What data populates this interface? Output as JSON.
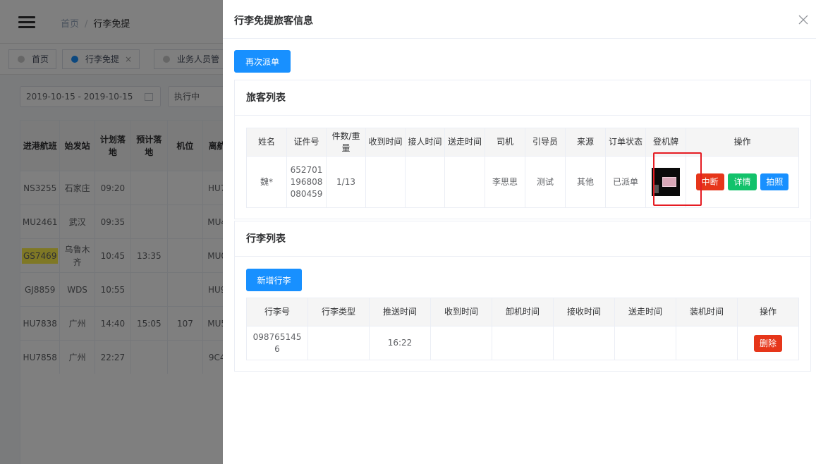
{
  "background": {
    "breadcrumb": {
      "home": "首页",
      "sep": "/",
      "current": "行李免提"
    },
    "tags": [
      {
        "label": "首页"
      },
      {
        "label": "行李免提",
        "close": "×"
      },
      {
        "label": "业务人员管"
      }
    ],
    "filters": {
      "date_range": "2019-10-15 - 2019-10-15",
      "status": "执行中"
    },
    "table": {
      "headers": [
        "进港航班",
        "始发站",
        "计划落地",
        "预计落地",
        "机位",
        "离航"
      ],
      "rows": [
        [
          "NS3255",
          "石家庄",
          "09:20",
          "",
          "",
          "HU7"
        ],
        [
          "MU2461",
          "武汉",
          "09:35",
          "",
          "",
          "MU4"
        ],
        [
          "GS7469",
          "乌鲁木齐",
          "10:45",
          "13:35",
          "",
          "MU0"
        ],
        [
          "GJ8859",
          "WDS",
          "10:55",
          "",
          "",
          "HU9"
        ],
        [
          "HU7838",
          "广州",
          "14:40",
          "15:05",
          "107",
          "MU5"
        ],
        [
          "HU7858",
          "广州",
          "22:27",
          "",
          "",
          "9C4"
        ]
      ]
    }
  },
  "drawer": {
    "title": "行李免提旅客信息",
    "redispatch_label": "再次派单",
    "passenger_section": {
      "title": "旅客列表",
      "headers": [
        "姓名",
        "证件号",
        "件数/重量",
        "收到时间",
        "接人时间",
        "送走时间",
        "司机",
        "引导员",
        "来源",
        "订单状态",
        "登机牌",
        "操作"
      ],
      "row": {
        "name": "魏*",
        "id_no": "652701196808080459",
        "count_weight": "1/13",
        "received": "",
        "pickup": "",
        "sent": "",
        "driver": "李思思",
        "guide": "测试",
        "source": "其他",
        "status": "已派单"
      },
      "actions": {
        "interrupt": "中断",
        "detail": "详情",
        "photo": "拍照"
      }
    },
    "baggage_section": {
      "title": "行李列表",
      "add_label": "新增行李",
      "headers": [
        "行李号",
        "行李类型",
        "推送时间",
        "收到时间",
        "卸机时间",
        "接收时间",
        "送走时间",
        "装机时间",
        "操作"
      ],
      "row": {
        "tag_no": "0987651456",
        "type": "",
        "push_time": "16:22",
        "received": "",
        "unload": "",
        "accept": "",
        "sent": "",
        "load": ""
      },
      "delete_label": "删除"
    }
  }
}
